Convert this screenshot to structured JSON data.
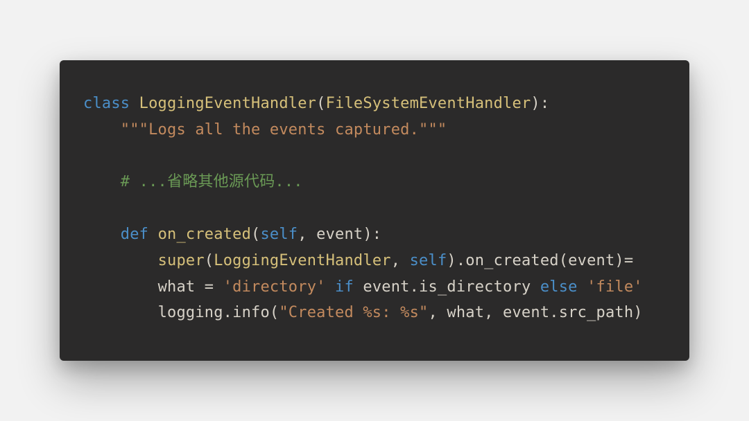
{
  "code": {
    "language": "python",
    "colors": {
      "background": "#2b2a2a",
      "page_bg": "#f2f2f2",
      "default": "#d7d2c8",
      "keyword": "#4b8fc9",
      "classname": "#d6c07a",
      "funcname": "#d6c07a",
      "string": "#c38a5e",
      "comment": "#6a9955"
    },
    "lines": [
      {
        "indent": 0,
        "tokens": [
          {
            "t": "class ",
            "c": "kw"
          },
          {
            "t": "LoggingEventHandler",
            "c": "cls"
          },
          {
            "t": "(",
            "c": "default"
          },
          {
            "t": "FileSystemEventHandler",
            "c": "cls"
          },
          {
            "t": "):",
            "c": "default"
          }
        ]
      },
      {
        "indent": 1,
        "tokens": [
          {
            "t": "\"\"\"Logs all the events captured.\"\"\"",
            "c": "str"
          }
        ]
      },
      {
        "indent": 0,
        "tokens": []
      },
      {
        "indent": 1,
        "tokens": [
          {
            "t": "# ...省略其他源代码...",
            "c": "cmt"
          }
        ]
      },
      {
        "indent": 0,
        "tokens": []
      },
      {
        "indent": 1,
        "tokens": [
          {
            "t": "def ",
            "c": "kw"
          },
          {
            "t": "on_created",
            "c": "fn"
          },
          {
            "t": "(",
            "c": "default"
          },
          {
            "t": "self",
            "c": "self"
          },
          {
            "t": ", event):",
            "c": "default"
          }
        ]
      },
      {
        "indent": 2,
        "tokens": [
          {
            "t": "super",
            "c": "builtin"
          },
          {
            "t": "(",
            "c": "default"
          },
          {
            "t": "LoggingEventHandler",
            "c": "cls"
          },
          {
            "t": ", ",
            "c": "default"
          },
          {
            "t": "self",
            "c": "self"
          },
          {
            "t": ").on_created(event)=",
            "c": "default"
          }
        ]
      },
      {
        "indent": 2,
        "tokens": [
          {
            "t": "what = ",
            "c": "default"
          },
          {
            "t": "'directory'",
            "c": "str"
          },
          {
            "t": " ",
            "c": "default"
          },
          {
            "t": "if",
            "c": "kw"
          },
          {
            "t": " event.is_directory ",
            "c": "default"
          },
          {
            "t": "else",
            "c": "kw"
          },
          {
            "t": " ",
            "c": "default"
          },
          {
            "t": "'file'",
            "c": "str"
          }
        ]
      },
      {
        "indent": 2,
        "tokens": [
          {
            "t": "logging.info(",
            "c": "default"
          },
          {
            "t": "\"Created %s: %s\"",
            "c": "str"
          },
          {
            "t": ", what, event.src_path)",
            "c": "default"
          }
        ]
      }
    ]
  }
}
